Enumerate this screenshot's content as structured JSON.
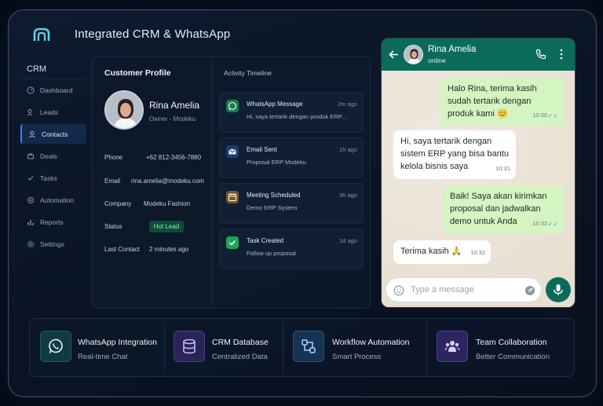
{
  "app": {
    "title": "Integrated CRM & WhatsApp",
    "logo_icon": "crm-logo-icon"
  },
  "sidebar": {
    "heading": "CRM",
    "items": [
      {
        "label": "Dashboard",
        "icon": "dashboard-icon"
      },
      {
        "label": "Leads",
        "icon": "leads-icon"
      },
      {
        "label": "Contacts",
        "icon": "contacts-icon",
        "active": true
      },
      {
        "label": "Deals",
        "icon": "deals-icon"
      },
      {
        "label": "Tasks",
        "icon": "tasks-icon"
      },
      {
        "label": "Automation",
        "icon": "automation-icon"
      },
      {
        "label": "Reports",
        "icon": "reports-icon"
      },
      {
        "label": "Settings",
        "icon": "settings-icon"
      }
    ]
  },
  "profile": {
    "title": "Customer Profile",
    "name": "Rina Amelia",
    "role": "Owner - Modeku",
    "fields": [
      {
        "label": "Phone",
        "value": "+62 812-3456-7880"
      },
      {
        "label": "Email",
        "value": "rina.amelia@modeku.com"
      },
      {
        "label": "Company",
        "value": "Modeku Fashion"
      },
      {
        "label": "Status",
        "value": "Hot Lead"
      },
      {
        "label": "Last Contact",
        "value": "2 minutes ago"
      }
    ]
  },
  "timeline": {
    "title": "Activity Timeline",
    "items": [
      {
        "title": "WhatsApp Message",
        "time": "2m ago",
        "sub": "Hi, saya tertarik dengan produk ERP...",
        "icon": "whatsapp-icon",
        "color": "#1e7a4f"
      },
      {
        "title": "Email Sent",
        "time": "1h ago",
        "sub": "Proposal ERP Modeku",
        "icon": "email-icon",
        "color": "#1d3b6e"
      },
      {
        "title": "Meeting Scheduled",
        "time": "3h ago",
        "sub": "Demo ERP System",
        "icon": "calendar-icon",
        "color": "#7a5a1e"
      },
      {
        "title": "Task Created",
        "time": "1d ago",
        "sub": "Follow up proposal",
        "icon": "checkbox-icon",
        "color": "#23a35a"
      }
    ]
  },
  "whatsapp": {
    "contact_name": "Rina Amelia",
    "status": "online",
    "messages": [
      {
        "dir": "out",
        "text": "Halo Rina, terima kasih sudah tertarik dengan produk kami 😊",
        "time": "10:30"
      },
      {
        "dir": "in",
        "text": "Hi, saya tertarik dengan sistem ERP yang bisa bantu kelola bisnis saya",
        "time": "10:31"
      },
      {
        "dir": "out",
        "text": "Baik! Saya akan kirimkan proposal dan jadwalkan demo untuk Anda",
        "time": "10:32"
      },
      {
        "dir": "in",
        "text": "Terima kasih 🙏",
        "time": "10:32"
      }
    ],
    "input_placeholder": "Type a message",
    "colors": {
      "header": "#0b6b5a",
      "outgoing": "#d4f4c2",
      "incoming": "#ffffff"
    }
  },
  "features": [
    {
      "title": "WhatsApp Integration",
      "sub": "Real-time Chat",
      "icon": "whatsapp-icon"
    },
    {
      "title": "CRM Database",
      "sub": "Centralized Data",
      "icon": "database-icon"
    },
    {
      "title": "Workflow Automation",
      "sub": "Smart Process",
      "icon": "workflow-icon"
    },
    {
      "title": "Team Collaboration",
      "sub": "Better Communication",
      "icon": "team-icon"
    }
  ]
}
